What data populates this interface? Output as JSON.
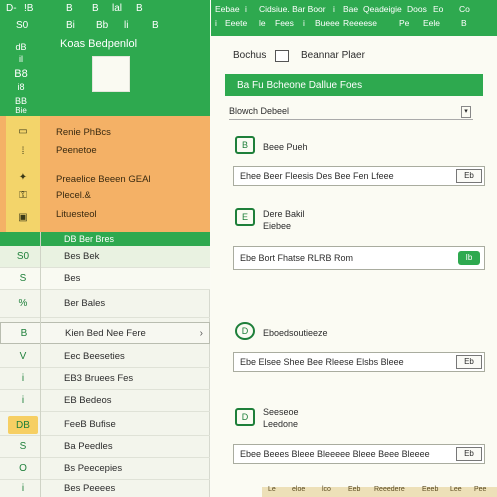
{
  "topbar": {
    "row1": [
      "D- ",
      "!B",
      "B",
      "B",
      "lal",
      "B"
    ],
    "row2": [
      "S0",
      "Bi",
      "Bb",
      "li",
      "B"
    ]
  },
  "rail": {
    "items": [
      "dB",
      "il",
      "B8",
      "i8",
      "BB",
      "Bie"
    ]
  },
  "brand": {
    "title": "Koas Bedpenlol"
  },
  "orange": {
    "items": [
      "Renie PhBcs",
      "Peenetoe",
      "Preaelice Beeen GEAl",
      "Plecel.&",
      "Lituesteol"
    ]
  },
  "list": {
    "header": "DB Ber Bres",
    "rows": [
      {
        "icon": "S0",
        "label": "Bes Bek"
      },
      {
        "icon": "S",
        "label": "Bes"
      },
      {
        "icon": "%",
        "label": "Ber Bales"
      },
      {
        "icon": "B",
        "label": "Kien Bed Nee Fere"
      },
      {
        "icon": "V",
        "label": "Eec Beeseties"
      },
      {
        "icon": "i",
        "label": "EB3 Bruees Fes"
      },
      {
        "icon": "i",
        "label": "EB Bedeos"
      },
      {
        "icon": "DB",
        "label": "FeeB Bufise"
      },
      {
        "icon": "S",
        "label": "Ba Peedles"
      },
      {
        "icon": "O",
        "label": "Bs Peecepies"
      },
      {
        "icon": "i",
        "label": "Bes Peeees"
      }
    ]
  },
  "right": {
    "top": [
      "Eebae",
      "i",
      "Cidsiue. Bar Boor",
      "i",
      "Bae",
      "Qeadeigie",
      "Doos",
      "Eo",
      "Co"
    ],
    "top2": [
      "i",
      "Eeete",
      "le",
      "Fees",
      "i",
      "Bueee",
      "Reeeese",
      "Pe",
      "Eele",
      "B"
    ],
    "checkbox_label": "Bochus",
    "title": "Beannar Plaer",
    "green_bar": "Ba Fu Bcheone Dallue Foes",
    "select_label": "Blowch Debeel",
    "sections": [
      {
        "icon": "B",
        "title": "Beee Pueh",
        "input": "Ehee Beer Fleesis Des Bee Fen Lfeee",
        "btn": "Eb"
      },
      {
        "icon": "E",
        "title": "Dere Bakil\nEiebee",
        "input": "Ebe Bort Fhatse RLRB Rom",
        "btn": "Ib"
      },
      {
        "icon": "D",
        "title": "Eboedsoutieeze",
        "input": "Ebe Elsee Shee Bee Rleese Elsbs Bleee",
        "btn": "Eb"
      },
      {
        "icon": "D",
        "title": "Seeseoe\nLeedone",
        "input": "Ebee Beees Bleee Bleeeee Bleee Beee Bleeee",
        "btn": "Eb"
      }
    ]
  },
  "footer": [
    "Le",
    "eloe",
    "lco",
    "Eeb",
    "Reeedere",
    "Eeeb",
    "Lee",
    "Pee"
  ],
  "colors": {
    "green": "#2ea94f",
    "orange": "#f4b166",
    "yellow": "#f3d46a",
    "background": "#fbfbf4"
  }
}
